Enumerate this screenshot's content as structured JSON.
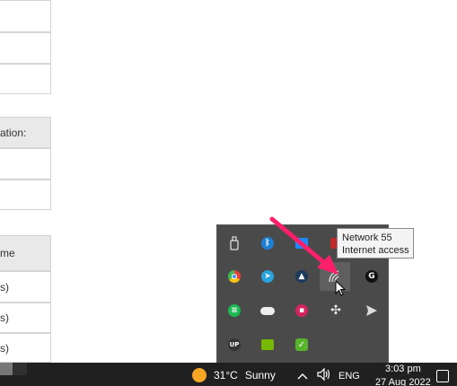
{
  "background_table": {
    "header_1": "ation:",
    "header_2": "me",
    "row_suffix_1": "s)",
    "row_suffix_2": "s)",
    "row_suffix_3": "s)"
  },
  "tray_popup": {
    "icons": [
      "usb-drive-icon",
      "bluetooth-icon",
      "dropbox-icon",
      "red-app-icon",
      "chrome-icon",
      "telegram-icon",
      "cloud-app-icon",
      "wifi-network-icon",
      "logitech-g-icon",
      "spotify-icon",
      "onedrive-icon",
      "red-dot-app-icon",
      "slack-icon",
      "send-arrow-icon",
      "up-app-icon",
      "nvidia-icon",
      "green-check-app-icon"
    ]
  },
  "tooltip": {
    "network_name": "Network 55",
    "status": "Internet access"
  },
  "taskbar": {
    "temperature": "31°C",
    "weather_condition": "Sunny",
    "language": "ENG",
    "time": "3:03 pm",
    "date": "27 Aug 2022"
  },
  "colors": {
    "taskbar_bg": "#202020",
    "popup_bg": "#4a4a4a",
    "arrow": "#ff1f6b"
  }
}
